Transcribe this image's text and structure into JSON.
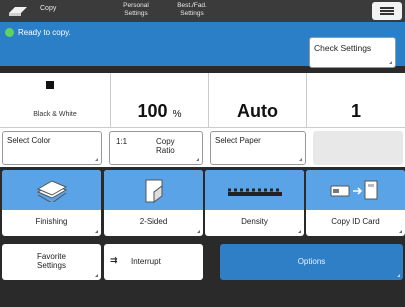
{
  "app": {
    "title": "Copy"
  },
  "tabs": [
    {
      "label_line1": "Personal",
      "label_line2": "Settings"
    },
    {
      "label_line1": "Best./Fad.",
      "label_line2": "Settings"
    }
  ],
  "status": {
    "text": "Ready to copy.",
    "check_settings": "Check Settings"
  },
  "info": {
    "color_mode": "Black & White",
    "ratio_value": "100",
    "ratio_unit": "%",
    "paper": "Auto",
    "copies": "1"
  },
  "mid_buttons": {
    "select_color": "Select Color",
    "ratio_prefix": "1:1",
    "copy_ratio_line1": "Copy",
    "copy_ratio_line2": "Ratio",
    "select_paper": "Select Paper"
  },
  "features": [
    {
      "label": "Finishing",
      "icon": "stack-icon"
    },
    {
      "label": "2-Sided",
      "icon": "page-fold-icon"
    },
    {
      "label": "Density",
      "icon": "density-slider-icon"
    },
    {
      "label": "Copy ID Card",
      "icon": "id-card-icon"
    }
  ],
  "bottom": {
    "favorite_line1": "Favorite",
    "favorite_line2": "Settings",
    "interrupt": "Interrupt",
    "options": "Options"
  },
  "colors": {
    "accent": "#2a7fc7",
    "tile_blue": "#5aa3e6",
    "dark_bg": "#2a2a2a"
  }
}
